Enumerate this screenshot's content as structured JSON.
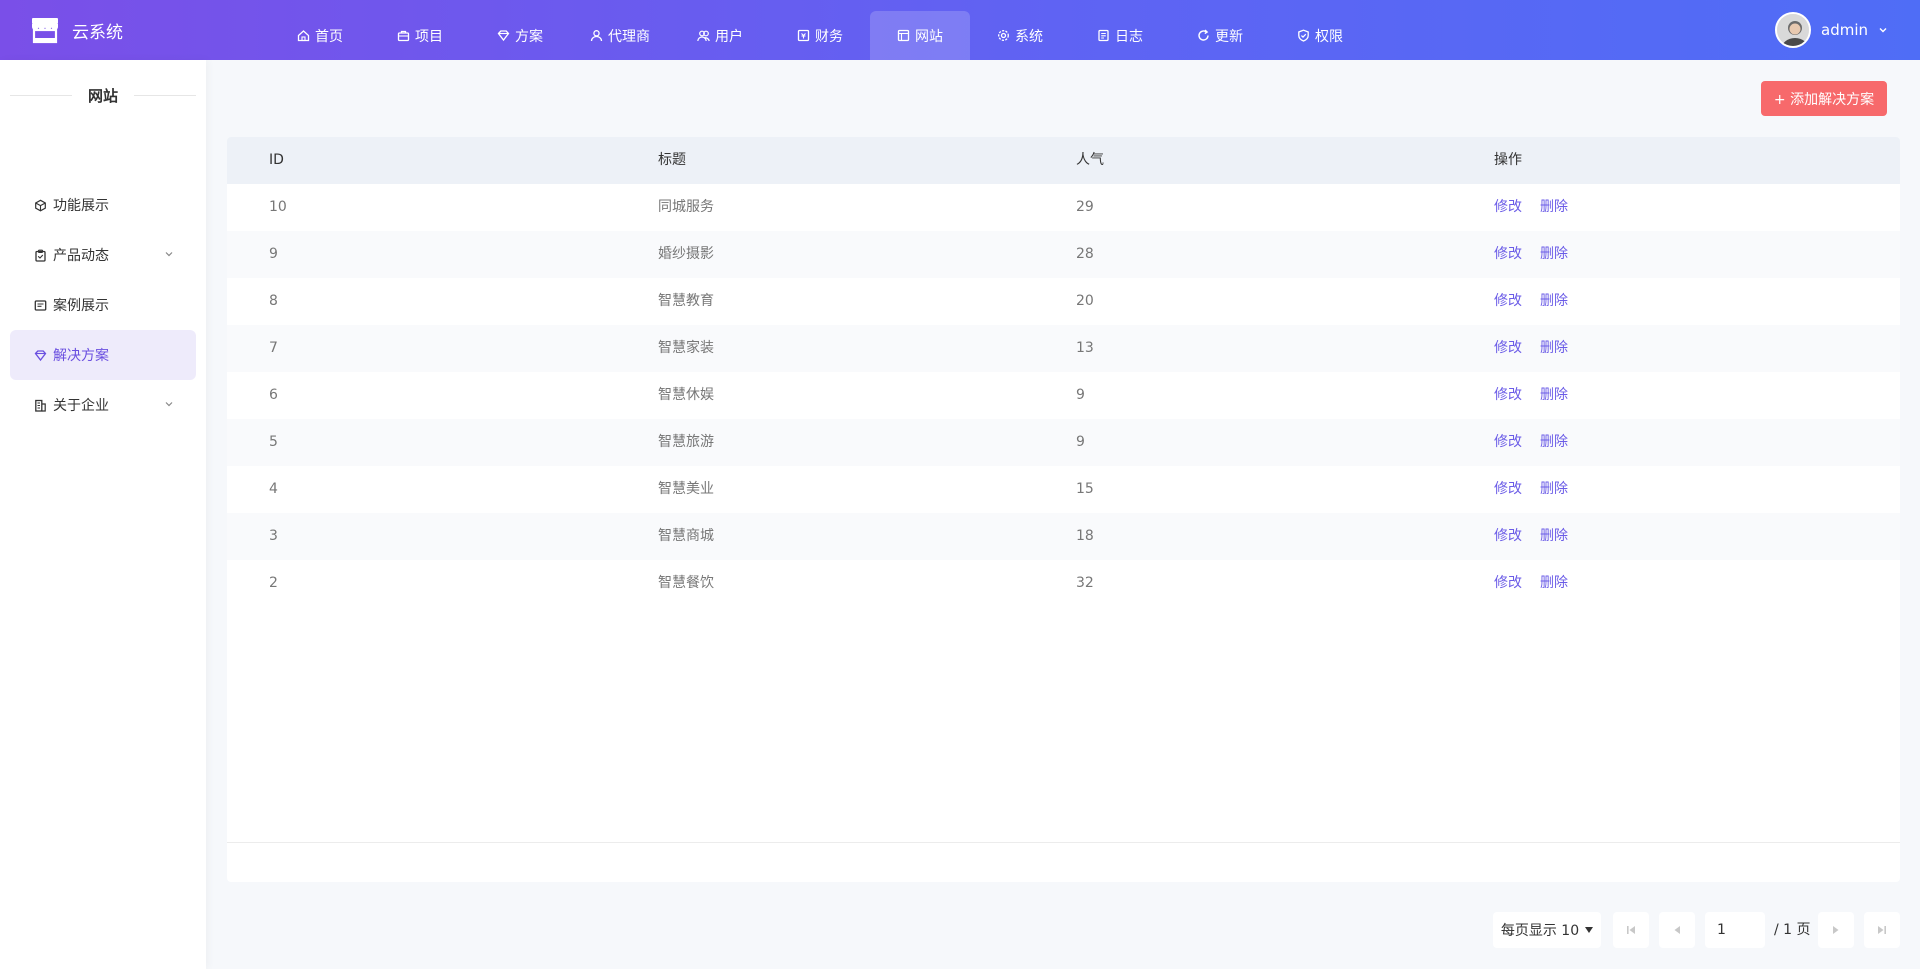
{
  "app": {
    "name": "云系统"
  },
  "nav": [
    {
      "label": "首页",
      "icon": "home-icon"
    },
    {
      "label": "项目",
      "icon": "briefcase-icon"
    },
    {
      "label": "方案",
      "icon": "diamond-icon"
    },
    {
      "label": "代理商",
      "icon": "user-icon"
    },
    {
      "label": "用户",
      "icon": "users-icon"
    },
    {
      "label": "财务",
      "icon": "finance-icon"
    },
    {
      "label": "网站",
      "icon": "layout-icon",
      "active": true
    },
    {
      "label": "系统",
      "icon": "gear-icon"
    },
    {
      "label": "日志",
      "icon": "log-icon"
    },
    {
      "label": "更新",
      "icon": "refresh-icon"
    },
    {
      "label": "权限",
      "icon": "shield-icon"
    }
  ],
  "user": {
    "name": "admin"
  },
  "sidebar": {
    "title": "网站",
    "items": [
      {
        "label": "功能展示",
        "icon": "cube-icon",
        "has_children": false
      },
      {
        "label": "产品动态",
        "icon": "clipboard-icon",
        "has_children": true
      },
      {
        "label": "案例展示",
        "icon": "card-icon",
        "has_children": false
      },
      {
        "label": "解决方案",
        "icon": "diamond-icon",
        "has_children": false,
        "active": true
      },
      {
        "label": "关于企业",
        "icon": "building-icon",
        "has_children": true
      }
    ]
  },
  "toolbar": {
    "add_label": "+ 添加解决方案"
  },
  "table": {
    "headers": {
      "id": "ID",
      "title": "标题",
      "popularity": "人气",
      "actions": "操作"
    },
    "rows": [
      {
        "id": "10",
        "title": "同城服务",
        "popularity": "29"
      },
      {
        "id": "9",
        "title": "婚纱摄影",
        "popularity": "28"
      },
      {
        "id": "8",
        "title": "智慧教育",
        "popularity": "20"
      },
      {
        "id": "7",
        "title": "智慧家装",
        "popularity": "13"
      },
      {
        "id": "6",
        "title": "智慧休娱",
        "popularity": "9"
      },
      {
        "id": "5",
        "title": "智慧旅游",
        "popularity": "9"
      },
      {
        "id": "4",
        "title": "智慧美业",
        "popularity": "15"
      },
      {
        "id": "3",
        "title": "智慧商城",
        "popularity": "18"
      },
      {
        "id": "2",
        "title": "智慧餐饮",
        "popularity": "32"
      }
    ],
    "edit_label": "修改",
    "delete_label": "删除"
  },
  "pagination": {
    "page_size_label": "每页显示 10",
    "current_page": "1",
    "total_label": "/ 1 页"
  }
}
